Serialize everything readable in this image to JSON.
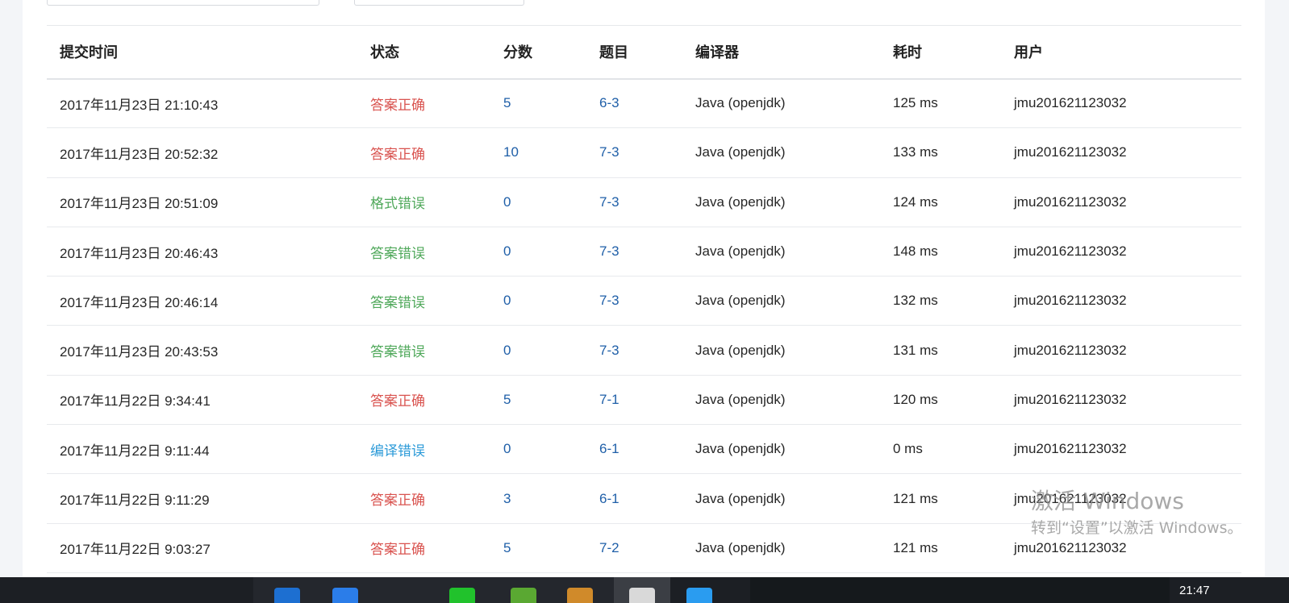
{
  "table": {
    "headers": {
      "time": "提交时间",
      "status": "状态",
      "score": "分数",
      "problem": "题目",
      "compiler": "编译器",
      "elapsed": "耗时",
      "user": "用户"
    },
    "rows": [
      {
        "time": "2017年11月23日 21:10:43",
        "status": "答案正确",
        "status_type": "ac",
        "score": "5",
        "problem": "6-3",
        "compiler": "Java (openjdk)",
        "elapsed": "125 ms",
        "user": "jmu201621123032"
      },
      {
        "time": "2017年11月23日 20:52:32",
        "status": "答案正确",
        "status_type": "ac",
        "score": "10",
        "problem": "7-3",
        "compiler": "Java (openjdk)",
        "elapsed": "133 ms",
        "user": "jmu201621123032"
      },
      {
        "time": "2017年11月23日 20:51:09",
        "status": "格式错误",
        "status_type": "pe",
        "score": "0",
        "problem": "7-3",
        "compiler": "Java (openjdk)",
        "elapsed": "124 ms",
        "user": "jmu201621123032"
      },
      {
        "time": "2017年11月23日 20:46:43",
        "status": "答案错误",
        "status_type": "wa",
        "score": "0",
        "problem": "7-3",
        "compiler": "Java (openjdk)",
        "elapsed": "148 ms",
        "user": "jmu201621123032"
      },
      {
        "time": "2017年11月23日 20:46:14",
        "status": "答案错误",
        "status_type": "wa",
        "score": "0",
        "problem": "7-3",
        "compiler": "Java (openjdk)",
        "elapsed": "132 ms",
        "user": "jmu201621123032"
      },
      {
        "time": "2017年11月23日 20:43:53",
        "status": "答案错误",
        "status_type": "wa",
        "score": "0",
        "problem": "7-3",
        "compiler": "Java (openjdk)",
        "elapsed": "131 ms",
        "user": "jmu201621123032"
      },
      {
        "time": "2017年11月22日 9:34:41",
        "status": "答案正确",
        "status_type": "ac",
        "score": "5",
        "problem": "7-1",
        "compiler": "Java (openjdk)",
        "elapsed": "120 ms",
        "user": "jmu201621123032"
      },
      {
        "time": "2017年11月22日 9:11:44",
        "status": "编译错误",
        "status_type": "ce",
        "score": "0",
        "problem": "6-1",
        "compiler": "Java (openjdk)",
        "elapsed": "0 ms",
        "user": "jmu201621123032"
      },
      {
        "time": "2017年11月22日 9:11:29",
        "status": "答案正确",
        "status_type": "ac",
        "score": "3",
        "problem": "6-1",
        "compiler": "Java (openjdk)",
        "elapsed": "121 ms",
        "user": "jmu201621123032"
      },
      {
        "time": "2017年11月22日 9:03:27",
        "status": "答案正确",
        "status_type": "ac",
        "score": "5",
        "problem": "7-2",
        "compiler": "Java (openjdk)",
        "elapsed": "121 ms",
        "user": "jmu201621123032"
      }
    ]
  },
  "watermark": {
    "title": "激活 Windows",
    "subtitle": "转到“设置”以激活 Windows。"
  },
  "taskbar": {
    "clock": "21:47",
    "icons": [
      {
        "name": "edge-icon",
        "color": "#1d6fd1"
      },
      {
        "name": "explorer-icon",
        "color": "#2b7de9"
      },
      {
        "name": "wechat-icon",
        "color": "#21c22c"
      },
      {
        "name": "browser-icon",
        "color": "#5aa832"
      },
      {
        "name": "app-icon",
        "color": "#d08a2a"
      },
      {
        "name": "eclipse-icon",
        "color": "#d9d9d9"
      },
      {
        "name": "qq-icon",
        "color": "#2a9cf0"
      }
    ]
  }
}
